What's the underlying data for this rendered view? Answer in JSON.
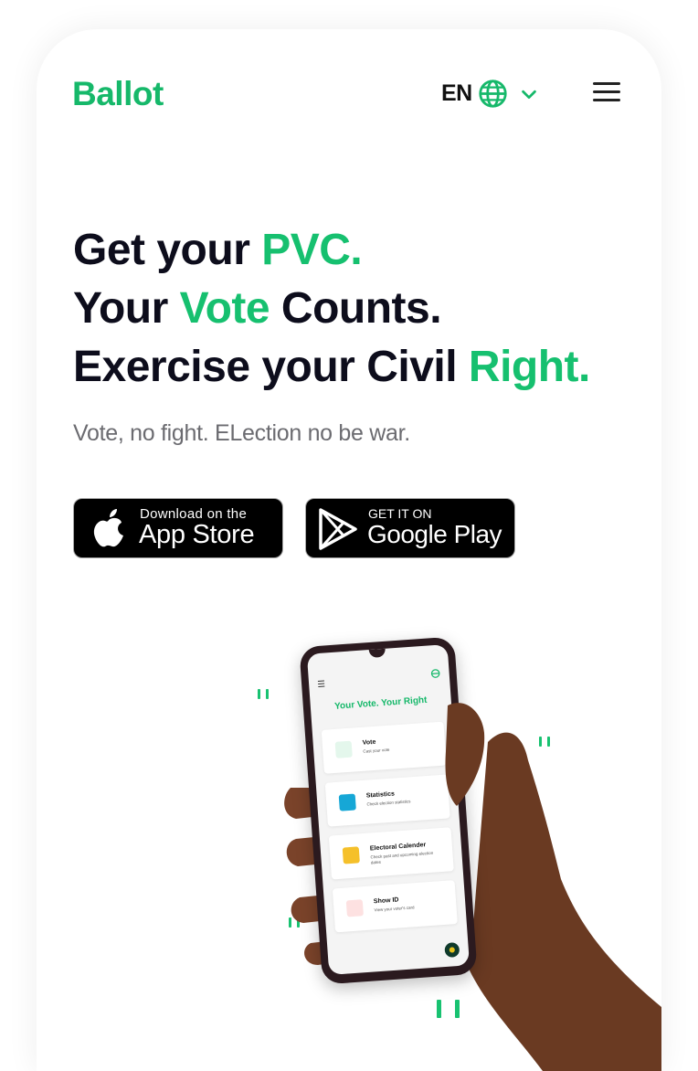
{
  "header": {
    "logo": "Ballot",
    "language": "EN",
    "globe_icon": "globe-icon",
    "chevron_icon": "chevron-down-icon",
    "menu_icon": "hamburger-menu-icon"
  },
  "hero": {
    "line1_a": "Get your ",
    "line1_b": "PVC.",
    "line2_a": "Your ",
    "line2_b": "Vote",
    "line2_c": " Counts.",
    "line3_a": "Exercise your Civil ",
    "line3_b": "Right.",
    "subtitle": "Vote, no fight. ELection no be war."
  },
  "stores": {
    "apple_small": "Download on the",
    "apple_big": "App Store",
    "google_small": "GET IT ON",
    "google_big": "Google Play"
  },
  "phone": {
    "title": "Your Vote. Your Right",
    "items": [
      {
        "label": "Vote",
        "desc": "Cast your vote"
      },
      {
        "label": "Statistics",
        "desc": "Check election statistics"
      },
      {
        "label": "Electoral Calender",
        "desc": "Check past and upcoming election dates"
      },
      {
        "label": "Show ID",
        "desc": "View your voter's card"
      }
    ]
  },
  "colors": {
    "brand": "#16b86a",
    "heading": "#0d0d1c",
    "subtitle": "#6b6b70"
  }
}
